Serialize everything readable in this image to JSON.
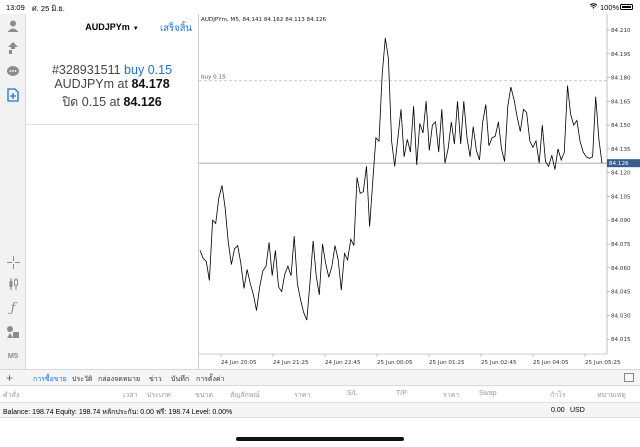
{
  "status_bar": {
    "time": "13:09",
    "date": "ศ. 25 มิ.ย.",
    "battery": "100%"
  },
  "left_toolbar": {
    "tools": [
      {
        "icon": "account-icon"
      },
      {
        "icon": "trade-arrows-icon"
      },
      {
        "icon": "chat-icon"
      },
      {
        "icon": "new-order-icon",
        "active": true
      },
      {
        "icon": "crosshair-icon"
      },
      {
        "icon": "candlestick-icon"
      },
      {
        "icon": "indicator-function-icon"
      },
      {
        "icon": "objects-icon"
      },
      {
        "icon": "timeframe-icon",
        "label": "M5"
      }
    ]
  },
  "order_panel": {
    "symbol": "AUDJPYm",
    "done_label": "เสร็จสิ้น",
    "ticket": "#328931511",
    "side": "buy",
    "volume": "0.15",
    "open_symbol": "AUDJPYm",
    "at_word": "at",
    "open_price": "84.178",
    "close_word": "ปิด",
    "close_volume": "0.15",
    "close_price": "84.126"
  },
  "chart": {
    "header": "AUDJPYm, M5, 84.141 84.162 84.113 84.126",
    "order_line_label": "buy 0.15",
    "current_price_label": "84.126",
    "colors": {
      "price_line": "#000000",
      "bid_line": "#9aa3ad",
      "order_line": "#bbbbbb",
      "price_tag": "#3a5d8c",
      "grid": "#eeeeee"
    }
  },
  "chart_data": {
    "type": "line",
    "symbol": "AUDJPYm",
    "timeframe": "M5",
    "ylim": [
      84.005,
      84.21
    ],
    "y_ticks": [
      "84.210",
      "84.195",
      "84.180",
      "84.165",
      "84.150",
      "84.135",
      "84.120",
      "84.105",
      "84.090",
      "84.075",
      "84.060",
      "84.045",
      "84.030",
      "84.015"
    ],
    "x_ticks": [
      "24 Jun 20:05",
      "24 Jun 21:25",
      "24 Jun 22:45",
      "25 Jun 00:05",
      "25 Jun 01:25",
      "25 Jun 02:45",
      "25 Jun 04:05",
      "25 Jun 05:25"
    ],
    "order_level": 84.178,
    "current_price": 84.126,
    "values": [
      84.071,
      84.066,
      84.064,
      84.052,
      84.09,
      84.088,
      84.104,
      84.112,
      84.098,
      84.076,
      84.062,
      84.072,
      84.074,
      84.063,
      84.047,
      84.059,
      84.05,
      84.043,
      84.033,
      84.048,
      84.058,
      84.061,
      84.076,
      84.055,
      84.071,
      84.048,
      84.045,
      84.056,
      84.061,
      84.055,
      84.08,
      84.05,
      84.04,
      84.032,
      84.027,
      84.05,
      84.077,
      84.055,
      84.043,
      84.075,
      84.063,
      84.054,
      84.061,
      84.074,
      84.065,
      84.046,
      84.069,
      84.065,
      84.078,
      84.074,
      84.117,
      84.107,
      84.108,
      84.124,
      84.086,
      84.114,
      84.142,
      84.14,
      84.182,
      84.205,
      84.192,
      84.14,
      84.124,
      84.142,
      84.16,
      84.13,
      84.141,
      84.133,
      84.162,
      84.125,
      84.151,
      84.145,
      84.165,
      84.134,
      84.15,
      84.152,
      84.133,
      84.16,
      84.126,
      84.135,
      84.152,
      84.138,
      84.165,
      84.138,
      84.165,
      84.142,
      84.13,
      84.149,
      84.134,
      84.128,
      84.152,
      84.163,
      84.137,
      84.142,
      84.143,
      84.152,
      84.135,
      84.127,
      84.162,
      84.174,
      84.166,
      84.155,
      84.146,
      84.16,
      84.158,
      84.14,
      84.136,
      84.14,
      84.126,
      84.15,
      84.127,
      84.124,
      84.131,
      84.122,
      84.135,
      84.128,
      84.133,
      84.175,
      84.157,
      84.15,
      84.153,
      84.14,
      84.133,
      84.13,
      84.129,
      84.13,
      84.168,
      84.141,
      84.126
    ]
  },
  "tabs": {
    "items": [
      {
        "label": "การซื้อขาย",
        "active": true
      },
      {
        "label": "ประวัติ"
      },
      {
        "label": "กล่องจดหมาย"
      },
      {
        "label": "ข่าว"
      },
      {
        "label": "บันทึก"
      },
      {
        "label": "การตั้งค่า"
      }
    ]
  },
  "columns": [
    "คำสั่ง",
    "เวลา",
    "ประเภท",
    "ขนาด",
    "สัญลักษณ์",
    "ราคา",
    "S/L",
    "T/P",
    "ราคา",
    "Swap",
    "กำไร",
    "หมายเหตุ"
  ],
  "balance_bar": {
    "text": "Balance: 198.74 Equity: 198.74 หลักประกัน: 0.00 ฟรี: 198.74 Level: 0.00%",
    "total": "0.00",
    "currency": "USD"
  }
}
